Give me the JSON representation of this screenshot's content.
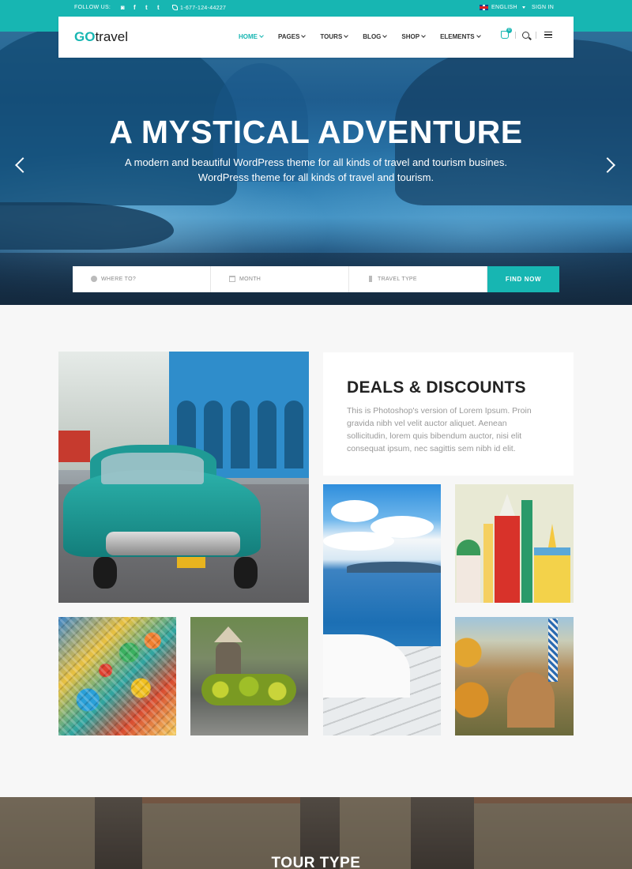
{
  "topbar": {
    "follow_label": "FOLLOW US:",
    "social": [
      "instagram-icon",
      "facebook-icon",
      "twitter-icon",
      "tumblr-icon"
    ],
    "social_glyphs": [
      "◙",
      "f",
      "t",
      "t"
    ],
    "phone": "1-677-124-44227",
    "language": "ENGLISH",
    "signin": "SIGN IN"
  },
  "header": {
    "logo_bold": "GO",
    "logo_rest": "travel",
    "nav": [
      {
        "label": "HOME",
        "active": true
      },
      {
        "label": "PAGES"
      },
      {
        "label": "TOURS"
      },
      {
        "label": "BLOG"
      },
      {
        "label": "SHOP"
      },
      {
        "label": "ELEMENTS"
      }
    ],
    "cart_count": "0"
  },
  "hero": {
    "title": "A MYSTICAL ADVENTURE",
    "subtitle_line1": "A modern and beautiful WordPress theme for all kinds of travel and tourism busines.",
    "subtitle_line2": "WordPress theme for all kinds of travel and tourism."
  },
  "search": {
    "where_placeholder": "WHERE TO?",
    "month_placeholder": "MONTH",
    "type_placeholder": "TRAVEL TYPE",
    "button": "FIND NOW"
  },
  "deals": {
    "title": "DEALS & DISCOUNTS",
    "text": "This is Photoshop's version of Lorem Ipsum. Proin gravida nibh vel velit auctor aliquet. Aenean sollicitudin, lorem quis bibendum auctor, nisi elit consequat ipsum, nec sagittis sem nibh id elit."
  },
  "tour": {
    "title": "TOUR TYPE"
  },
  "colors": {
    "accent": "#17b6b2",
    "heading": "#222222",
    "body_text": "#999999"
  }
}
